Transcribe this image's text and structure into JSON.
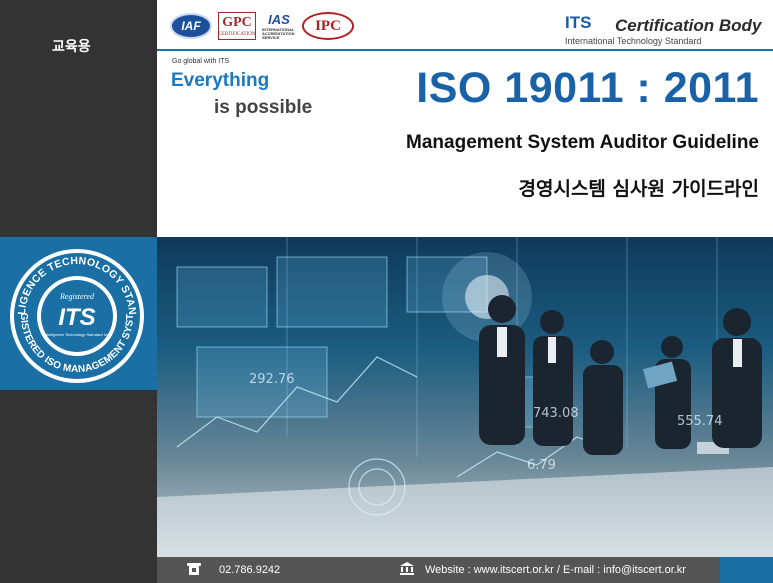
{
  "sidebar": {
    "edu_label": "교육용"
  },
  "seal": {
    "ring_top_text": "INTELLIGENCE TECHNOLOGY STANDARD",
    "ring_bottom_text": "REGISTERED ISO MANAGEMENT SYSTEM",
    "registered": "Registered",
    "center": "ITS",
    "center_sub": "Intelligence Technology Standard Inc."
  },
  "header": {
    "logos": {
      "iaf": "IAF",
      "gpc": "GPC",
      "gpc_sub": "CERTIFICATION",
      "ias": "IAS",
      "ias_sub": "INTERNATIONAL ACCREDITATION SERVICE",
      "ipc": "IPC"
    },
    "its": "ITS",
    "cert_body": "Certification Body",
    "its_sub": "International Technology Standard"
  },
  "tagline": {
    "go_global": "Go global with ITS",
    "everything": "Everything",
    "possible": "is possible"
  },
  "title": {
    "main": "ISO 19011 : 2011",
    "subtitle_en": "Management System Auditor Guideline",
    "subtitle_ko": "경영시스템 심사원 가이드라인"
  },
  "hero": {
    "numbers": [
      "292.76",
      "743.08",
      "555.74",
      "6.79"
    ]
  },
  "footer": {
    "phone": "02.786.9242",
    "web": "Website : www.itscert.or.kr  /   E-mail : info@itscert.or.kr"
  },
  "colors": {
    "brand_blue": "#1a6fa4",
    "dark": "#333333",
    "title_blue": "#1a62a8",
    "footer_gray": "#555555"
  }
}
